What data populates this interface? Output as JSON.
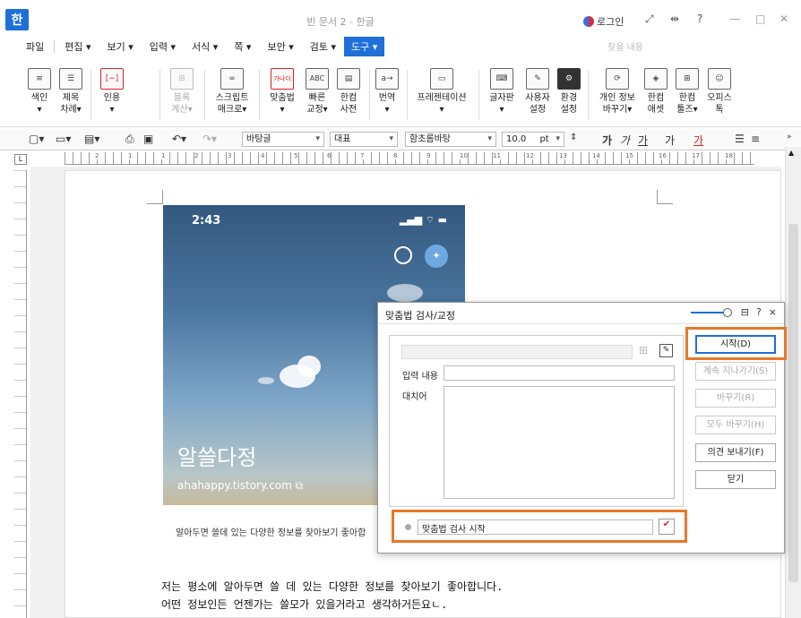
{
  "titlebar": {
    "app_icon": "한",
    "title": "빈 문서 2 - 한글",
    "login": "로그인",
    "controls": [
      "⤢",
      "⇹",
      "?",
      "—",
      "□",
      "✕"
    ]
  },
  "menu": {
    "items": [
      "파일",
      "편집 ▾",
      "보기 ▾",
      "입력 ▾",
      "서식 ▾",
      "쪽 ▾",
      "보안 ▾",
      "검토 ▾",
      "도구 ▾"
    ],
    "search_placeholder": "찾을 내용"
  },
  "ribbon": {
    "buttons": [
      {
        "l1": "색인",
        "l2": "▾",
        "icon": "index-icon",
        "glyph": "≡"
      },
      {
        "l1": "제목",
        "l2": "차례▾",
        "icon": "toc-icon",
        "glyph": "☰"
      },
      {
        "l1": "인용",
        "l2": "▾",
        "icon": "citation-icon",
        "glyph": "[−]"
      },
      {
        "l1": "블록",
        "l2": "계산▾",
        "icon": "block-calc-icon",
        "glyph": "⊞"
      },
      {
        "l1": "스크립트",
        "l2": "매크로▾",
        "icon": "script-macro-icon",
        "glyph": "∞"
      },
      {
        "l1": "맞춤법",
        "l2": "▾",
        "icon": "spellcheck-icon",
        "glyph": "가나다"
      },
      {
        "l1": "빠른",
        "l2": "교정▾",
        "icon": "quick-correct-icon",
        "glyph": "ABC"
      },
      {
        "l1": "한컴",
        "l2": "사전",
        "icon": "dictionary-icon",
        "glyph": "▤"
      },
      {
        "l1": "번역",
        "l2": "▾",
        "icon": "translate-icon",
        "glyph": "a→"
      },
      {
        "l1": "프레젠테이션",
        "l2": "▾",
        "icon": "presentation-icon",
        "glyph": "▭"
      },
      {
        "l1": "글자판",
        "l2": "▾",
        "icon": "keyboard-icon",
        "glyph": "⌨"
      },
      {
        "l1": "사용자",
        "l2": "설정",
        "icon": "user-settings-icon",
        "glyph": "✎"
      },
      {
        "l1": "환경",
        "l2": "설정",
        "icon": "gear-icon",
        "glyph": "⚙"
      },
      {
        "l1": "개인 정보",
        "l2": "바꾸기▾",
        "icon": "privacy-icon",
        "glyph": "⟳"
      },
      {
        "l1": "한컴",
        "l2": "애셋",
        "icon": "asset-icon",
        "glyph": "◈"
      },
      {
        "l1": "한컴",
        "l2": "툴즈▾",
        "icon": "tools-icon",
        "glyph": "⊞"
      },
      {
        "l1": "오피스",
        "l2": "톡",
        "icon": "office-talk-icon",
        "glyph": "☺"
      }
    ]
  },
  "format": {
    "style": "바탕글",
    "lang": "대표",
    "font": "함초롬바탕",
    "size": "10.0",
    "unit": "pt",
    "bold": "가",
    "italic": "가",
    "underline": "가",
    "strike": "가",
    "color": "가"
  },
  "ruler": {
    "numbers": [
      "2",
      "1",
      "1",
      "2",
      "3",
      "4",
      "5",
      "6",
      "7",
      "8",
      "9",
      "10",
      "11",
      "12",
      "13",
      "14",
      "15",
      "16",
      "17",
      "18"
    ],
    "corner": "L"
  },
  "document": {
    "image": {
      "time": "2:43",
      "status": "▂▄▆ ⌔ ▬",
      "title": "알쓸다정",
      "url": "ahahappy.tistory.com ⧉",
      "caption": "알아두면 쓸데 있는 다양한 정보를 찾아보기 좋아합"
    },
    "lines": [
      "저는 평소에 알아두면 쓸 데 있는 다양한 정보를 찾아보기 좋아합니다.",
      "어떤 정보인든 언젠가는 쓸모가 있을거라고 생각하거든요ㄴ."
    ]
  },
  "dialog": {
    "title": "맞춤법 검사/교정",
    "controls": [
      "⊟",
      "?",
      "×"
    ],
    "input_label": "입력 내용",
    "replace_label": "대치어",
    "status_text": "맞춤법 검사 시작",
    "buttons": {
      "start": "시작(D)",
      "skip": "계속 지나가기(S)",
      "replace": "바꾸기(R)",
      "replace_all": "모두 바꾸기(H)",
      "send_feedback": "의견 보내기(F)",
      "close": "닫기"
    },
    "highlight_color": "#e8782a"
  }
}
